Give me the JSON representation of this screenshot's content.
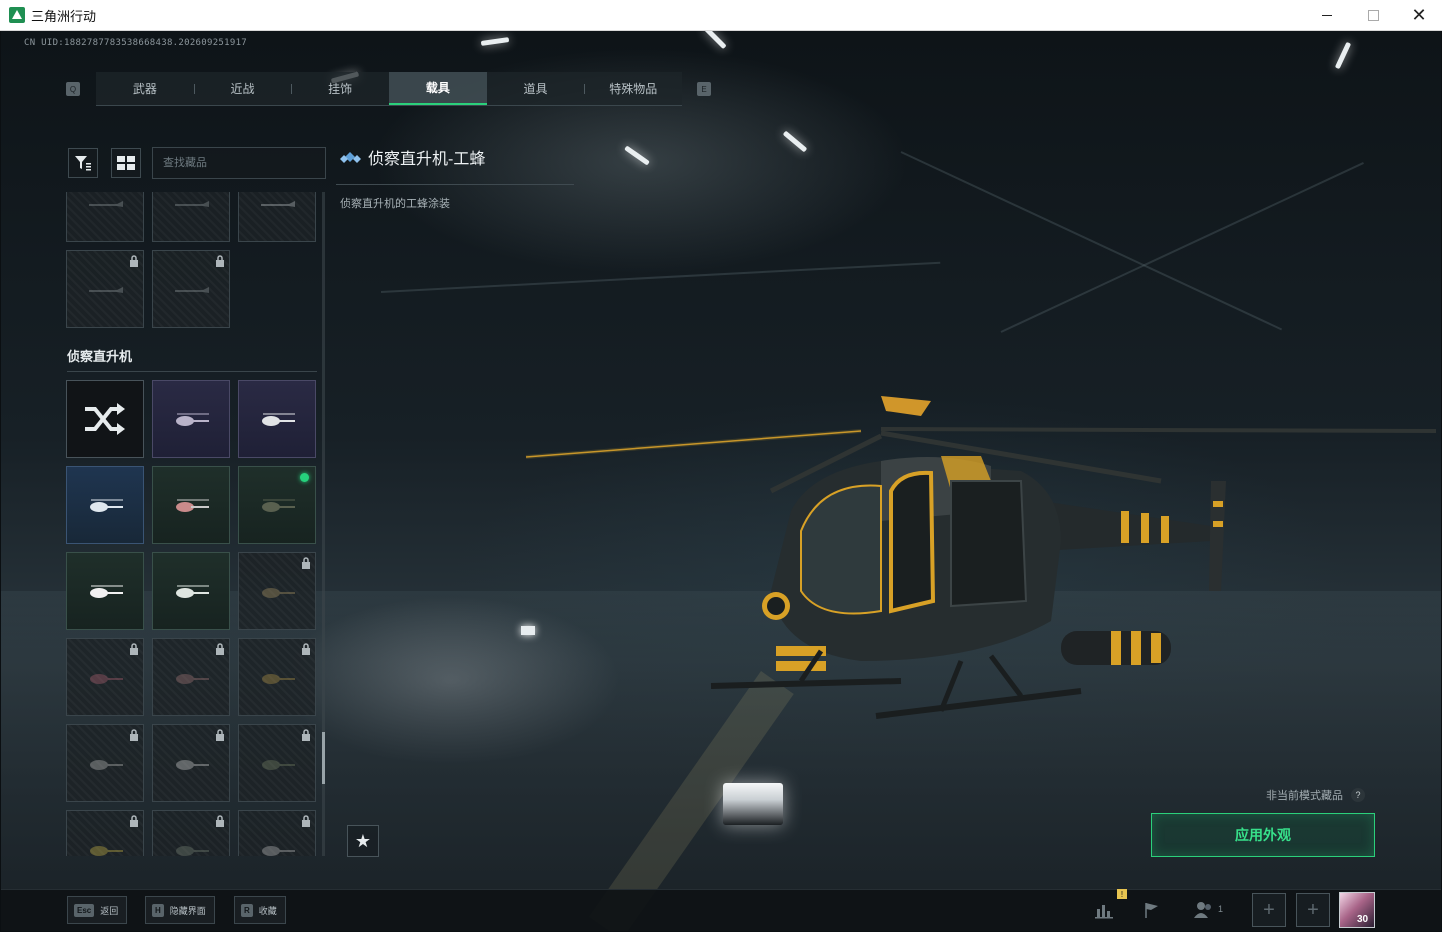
{
  "window": {
    "title": "三角洲行动"
  },
  "uid": "CN UID:1882787783538668438.202609251917",
  "tabs": {
    "left_key": "Q",
    "right_key": "E",
    "items": [
      {
        "label": "武器"
      },
      {
        "label": "近战"
      },
      {
        "label": "挂饰"
      },
      {
        "label": "载具",
        "active": true
      },
      {
        "label": "道具"
      },
      {
        "label": "特殊物品"
      }
    ]
  },
  "search": {
    "placeholder": "查找藏品",
    "value": ""
  },
  "section": {
    "title": "侦察直升机"
  },
  "detail": {
    "title": "侦察直升机-工蜂",
    "description": "侦察直升机的工蜂涂装"
  },
  "mode_note": {
    "text": "非当前模式藏品",
    "help": "?"
  },
  "apply_button": {
    "label": "应用外观"
  },
  "bottom_hints": [
    {
      "key": "Esc",
      "label": "返回"
    },
    {
      "key": "H",
      "label": "隐藏界面"
    },
    {
      "key": "R",
      "label": "收藏"
    }
  ],
  "bottom_right": {
    "badge": "!",
    "squad_count": "1",
    "avatar_level": "30"
  },
  "colors": {
    "accent": "#2bd07b",
    "rarity_purple": "#2a2a44",
    "rarity_blue": "#1f3550",
    "rarity_green": "#1f2f2a"
  },
  "icons": [
    "filter-icon",
    "grid-view-icon",
    "shuffle-icon",
    "star-icon",
    "lock-icon",
    "stats-icon",
    "flag-icon",
    "squad-icon",
    "plus-icon"
  ]
}
